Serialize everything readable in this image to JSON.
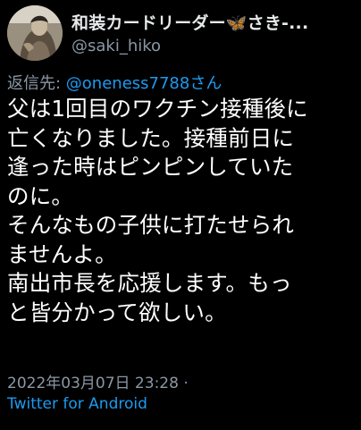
{
  "tweet": {
    "display_name": "和装カードリーダー🦋さき-...",
    "handle": "@saki_hiko",
    "replying_prefix": "返信先: ",
    "replying_to": "@oneness7788さん",
    "body_lines": [
      "父は1回目のワクチン接種後に",
      "亡くなりました。接種前日に",
      "逢った時はピンピンしていた",
      "のに。",
      "そんなもの子供に打たせられ",
      "ませんよ。",
      "南出市長を応援します。もっ",
      "と皆分かって欲しい。"
    ],
    "timestamp": "2022年03月07日 23:28 ·",
    "source": "Twitter for Android"
  },
  "colors": {
    "background": "#000000",
    "primary_text": "#e7e9ea",
    "secondary_text": "#8b98a5",
    "link": "#1d9bf0"
  },
  "icons": {
    "avatar": "user-avatar-photo"
  }
}
